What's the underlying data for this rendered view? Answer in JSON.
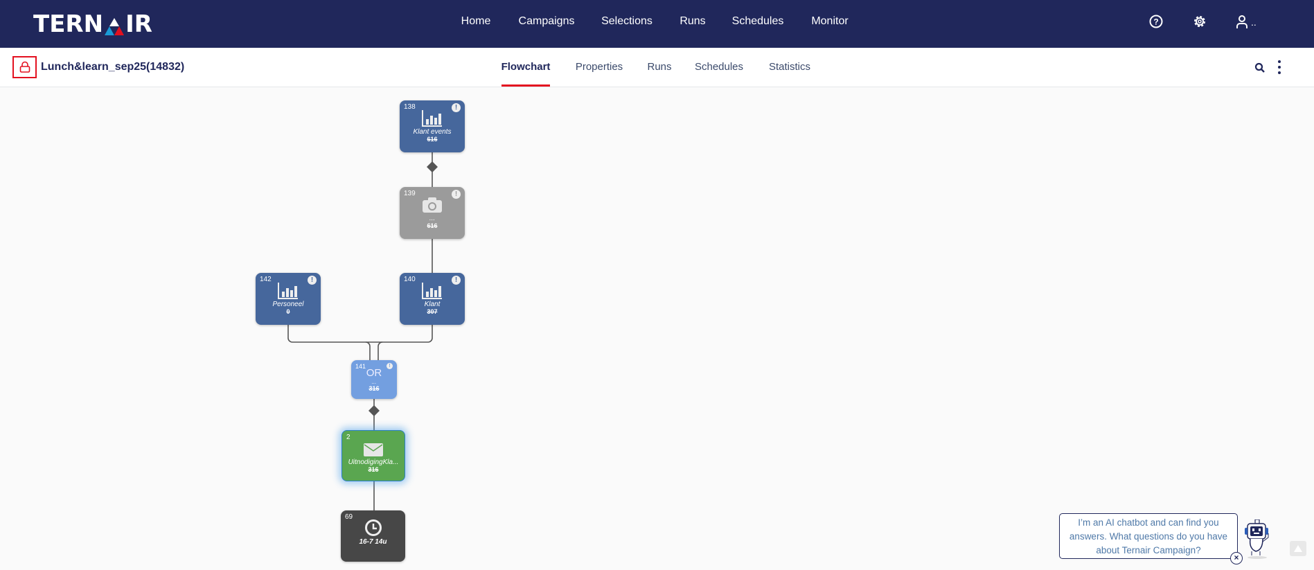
{
  "app": {
    "logo_text": "TERNAIR"
  },
  "nav": {
    "items": [
      "Home",
      "Campaigns",
      "Selections",
      "Runs",
      "Schedules",
      "Monitor"
    ],
    "user_label": ".."
  },
  "campaign": {
    "title": "Lunch&learn_sep25(14832)"
  },
  "tabs": [
    "Flowchart",
    "Properties",
    "Runs",
    "Schedules",
    "Statistics"
  ],
  "active_tab": "Flowchart",
  "nodes": [
    {
      "id": "138",
      "label": "Klant events",
      "count": "616",
      "type": "selection",
      "warning": true
    },
    {
      "id": "139",
      "label": "...",
      "count": "616",
      "type": "snapshot",
      "warning": true
    },
    {
      "id": "142",
      "label": "Personeel",
      "count": "0",
      "type": "selection",
      "warning": true
    },
    {
      "id": "140",
      "label": "Klant",
      "count": "307",
      "type": "selection",
      "warning": true
    },
    {
      "id": "141",
      "title": "OR",
      "label": "...",
      "count": "316",
      "type": "or",
      "warning": true
    },
    {
      "id": "2",
      "label": "UitnodigingKla...",
      "count": "316",
      "type": "email"
    },
    {
      "id": "69",
      "label": "16-7 14u",
      "type": "schedule"
    }
  ],
  "chatbot": {
    "message": "I’m an AI chatbot and can find you answers. What questions do you have about Ternair Campaign?",
    "close": "×"
  },
  "colors": {
    "header": "#20275b",
    "accent": "#e3101f",
    "node_blue": "#46679c",
    "node_green": "#5aa650"
  }
}
